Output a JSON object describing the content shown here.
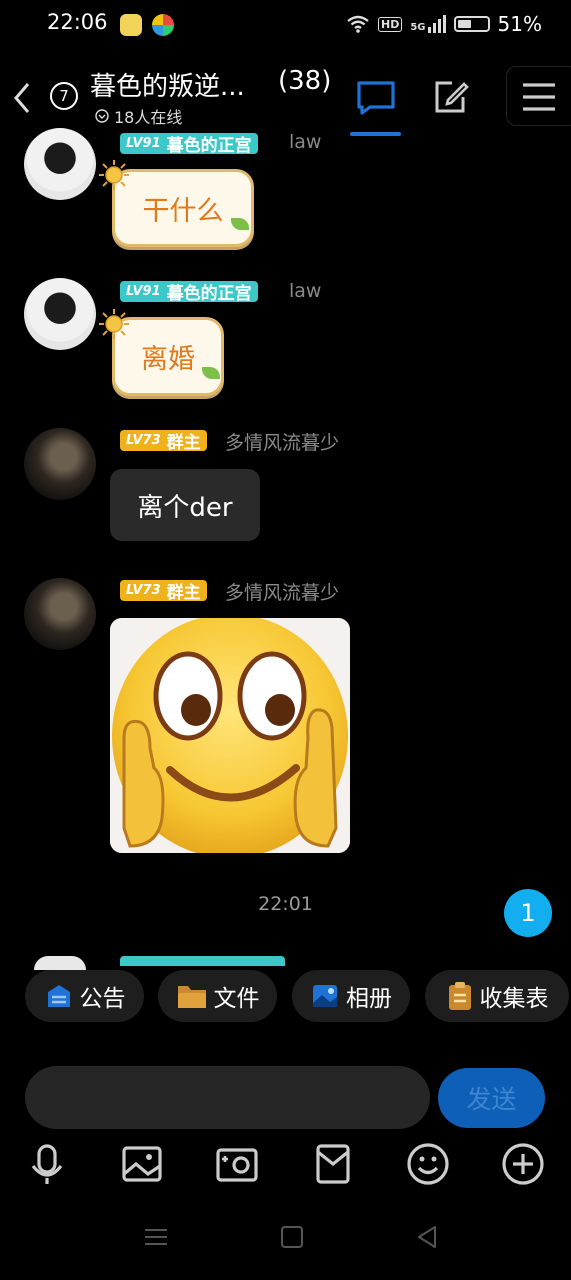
{
  "status_bar": {
    "time": "22:06",
    "hd": "HD",
    "network": "5G",
    "battery": "51%"
  },
  "header": {
    "unread_count": "7",
    "title": "暮色的叛逆...",
    "member_count": "(38)",
    "online": "18人在线"
  },
  "messages": [
    {
      "badge_level": "LV91",
      "badge_title": "暮色的正宫",
      "sender": "law",
      "text": "干什么"
    },
    {
      "badge_level": "LV91",
      "badge_title": "暮色的正宫",
      "sender": "law",
      "text": "离婚"
    },
    {
      "badge_level": "LV73",
      "badge_title": "群主",
      "sender": "多情风流暮少",
      "text": "离个der"
    },
    {
      "badge_level": "LV73",
      "badge_title": "群主",
      "sender": "多情风流暮少",
      "sticker": "smiley-sticker"
    }
  ],
  "timestamp": "22:01",
  "unread_badge": "1",
  "shortcuts": [
    {
      "label": "公告",
      "icon": "announcement-icon"
    },
    {
      "label": "文件",
      "icon": "folder-icon"
    },
    {
      "label": "相册",
      "icon": "album-icon"
    },
    {
      "label": "收集表",
      "icon": "clipboard-icon"
    }
  ],
  "input": {
    "value": "",
    "send_label": "发送"
  },
  "toolbar_icons": [
    "microphone-icon",
    "image-icon",
    "camera-icon",
    "red-packet-icon",
    "emoji-icon",
    "plus-icon"
  ],
  "colors": {
    "accent": "#1e74d6",
    "badge_teal": "#3cc7c9",
    "badge_gold": "#f0b21c",
    "unread": "#12aef0"
  }
}
